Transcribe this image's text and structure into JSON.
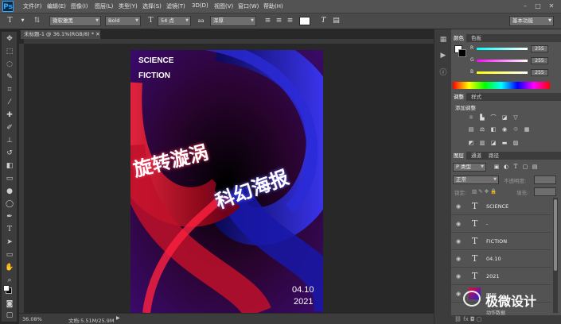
{
  "app": {
    "logo": "Ps",
    "menu": [
      "文件(F)",
      "编辑(E)",
      "图像(I)",
      "图层(L)",
      "类型(Y)",
      "选择(S)",
      "滤镜(T)",
      "3D(D)",
      "视图(V)",
      "窗口(W)",
      "帮助(H)"
    ],
    "window_controls": [
      "–",
      "□",
      "✕"
    ]
  },
  "options_bar": {
    "font_family": "微软雅黑",
    "font_style": "Bold",
    "font_size": "54 点",
    "antialias_label": "aa",
    "antialias": "浑厚",
    "workspace": "基本功能"
  },
  "document": {
    "tab_title": "未标题-1 @ 36.1%(RGB/8) *",
    "zoom": "36.08%",
    "doc_size": "文档:5.51M/25.9M"
  },
  "poster": {
    "title_line1": "SCIENCE",
    "title_line2": "FICTION",
    "text_red": "旋转漩涡",
    "text_blue": "科幻海报",
    "date": "04.10",
    "year": "2021",
    "colors": {
      "red": "#e0102a",
      "blue": "#1e1ee6",
      "dark": "#0a0014"
    }
  },
  "color_panel": {
    "tabs": [
      "颜色",
      "色板"
    ],
    "channels": [
      {
        "label": "R",
        "value": "255"
      },
      {
        "label": "G",
        "value": "255"
      },
      {
        "label": "B",
        "value": "255"
      }
    ]
  },
  "adjust_panel": {
    "tabs": [
      "调整",
      "样式"
    ],
    "title": "添加调整"
  },
  "layers_panel": {
    "tabs": [
      "图层",
      "通道",
      "路径"
    ],
    "kind_filter": "P 类型",
    "blend_mode": "正常",
    "opacity_label": "不透明度:",
    "lock_label": "锁定:",
    "fill_label": "填充:",
    "layers": [
      {
        "name": "SCIENCE",
        "type": "T"
      },
      {
        "name": "-",
        "type": "T"
      },
      {
        "name": "FICTION",
        "type": "T"
      },
      {
        "name": "04.10",
        "type": "T"
      },
      {
        "name": "2021",
        "type": "T"
      },
      {
        "name": "图层",
        "type": "img"
      }
    ],
    "partial_label": "动作数据"
  },
  "watermark": {
    "text": "极微设计"
  }
}
